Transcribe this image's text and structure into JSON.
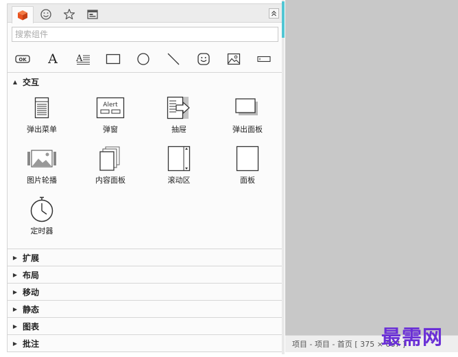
{
  "tabs": [
    {
      "icon": "cube-icon",
      "active": true
    },
    {
      "icon": "smiley-icon",
      "active": false
    },
    {
      "icon": "star-icon",
      "active": false
    },
    {
      "icon": "master-panel-icon",
      "active": false
    }
  ],
  "search": {
    "placeholder": "搜索组件",
    "value": ""
  },
  "toolbar": {
    "tools": [
      {
        "icon": "button-icon",
        "glyph": "OK"
      },
      {
        "icon": "text-icon",
        "glyph": "A"
      },
      {
        "icon": "paragraph-icon",
        "glyph": "A"
      },
      {
        "icon": "rectangle-icon"
      },
      {
        "icon": "circle-icon"
      },
      {
        "icon": "line-icon"
      },
      {
        "icon": "emoji-icon"
      },
      {
        "icon": "image-icon"
      },
      {
        "icon": "input-icon"
      }
    ]
  },
  "sections": {
    "interaction": {
      "title": "交互",
      "expanded": true,
      "items": [
        {
          "label": "弹出菜单",
          "icon": "popup-menu-icon"
        },
        {
          "label": "弹窗",
          "icon": "alert-dialog-icon",
          "glyph": "Alert"
        },
        {
          "label": "抽屉",
          "icon": "drawer-icon"
        },
        {
          "label": "弹出面板",
          "icon": "popup-panel-icon"
        },
        {
          "label": "图片轮播",
          "icon": "image-carousel-icon"
        },
        {
          "label": "内容面板",
          "icon": "content-panel-icon"
        },
        {
          "label": "滚动区",
          "icon": "scroll-area-icon"
        },
        {
          "label": "面板",
          "icon": "panel-icon"
        },
        {
          "label": "定时器",
          "icon": "timer-icon"
        }
      ]
    },
    "collapsed": [
      {
        "title": "扩展"
      },
      {
        "title": "布局"
      },
      {
        "title": "移动"
      },
      {
        "title": "静态"
      },
      {
        "title": "图表"
      },
      {
        "title": "批注"
      }
    ]
  },
  "status": {
    "text": "项目 - 项目 - 首页 [ 375 × 667 ]"
  },
  "watermark": "最需网",
  "colors": {
    "accent": "#e8531f",
    "splitter_accent": "#52c6d3",
    "watermark": "#6a2fd6",
    "canvas": "#c8c8c8"
  }
}
